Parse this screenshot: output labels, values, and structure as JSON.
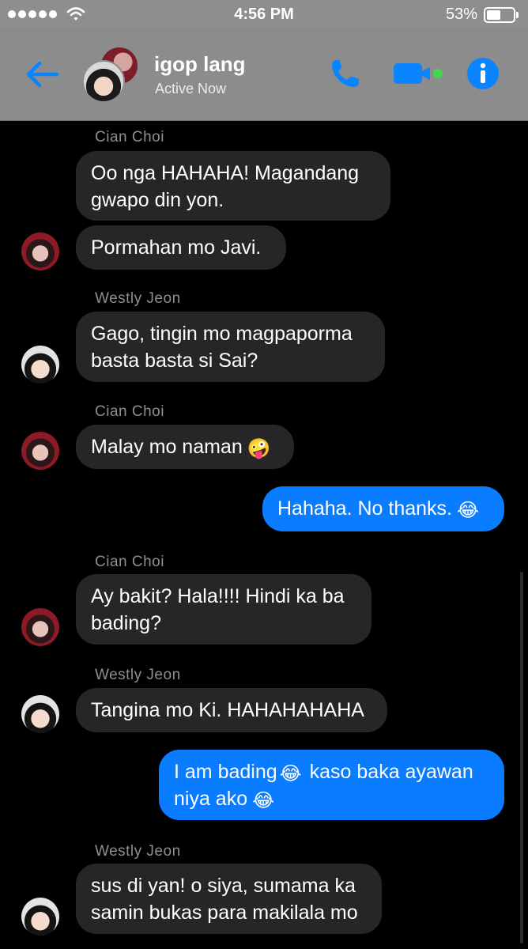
{
  "status_bar": {
    "time": "4:56 PM",
    "battery_percent_text": "53%",
    "battery_level": 0.53,
    "signal_icon": "signal-dots-icon",
    "wifi_icon": "wifi-icon"
  },
  "header": {
    "title": "igop lang",
    "status": "Active Now",
    "back_icon": "back-arrow-icon",
    "call_icon": "phone-icon",
    "video_icon": "video-camera-icon",
    "info_icon": "info-icon",
    "accent_color": "#0a84ff"
  },
  "messages": [
    {
      "sender": "Cian Choi",
      "text_lines": [
        "Oo nga HAHAHA! Magandang",
        "gwapo din yon."
      ]
    },
    {
      "text_lines": [
        "Pormahan mo Javi."
      ]
    },
    {
      "sender": "Westly Jeon",
      "text_lines": [
        "Gago, tingin mo magpaporma",
        "basta basta si Sai?"
      ]
    },
    {
      "sender": "Cian Choi",
      "text": "Malay mo naman",
      "emoji": "🤪"
    },
    {
      "text": "Hahaha. No thanks.",
      "emoji": "😂"
    },
    {
      "sender": "Cian Choi",
      "text_lines": [
        "Ay bakit? Hala!!!! Hindi ka ba",
        "bading?"
      ]
    },
    {
      "sender": "Westly Jeon",
      "text": "Tangina mo Ki. HAHAHAHAHA"
    },
    {
      "text_a": "I am bading",
      "emoji_a": "😂",
      "text_b": "kaso baka ayawan",
      "text_c": "niya ako",
      "emoji_c": "😂"
    },
    {
      "sender": "Westly Jeon",
      "text_lines": [
        "sus di yan! o siya, sumama ka",
        "samin bukas para makilala mo"
      ]
    }
  ],
  "colors": {
    "incoming_bubble": "#262628",
    "outgoing_bubble": "#0a7cff",
    "background": "#000000",
    "header_bg": "#8c8c8c"
  }
}
